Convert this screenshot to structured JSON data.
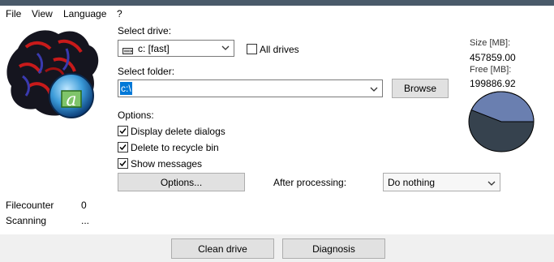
{
  "menu": {
    "file": "File",
    "view": "View",
    "language": "Language",
    "help": "?"
  },
  "drive": {
    "label": "Select drive:",
    "value": "c: [fast]",
    "all_drives_label": "All drives",
    "all_drives_checked": false
  },
  "folder": {
    "label": "Select folder:",
    "value": "c:\\",
    "browse_label": "Browse"
  },
  "options": {
    "heading": "Options:",
    "display_delete_dialogs": {
      "label": "Display delete dialogs",
      "checked": true
    },
    "delete_to_recycle_bin": {
      "label": "Delete to recycle bin",
      "checked": true
    },
    "show_messages": {
      "label": "Show messages",
      "checked": true
    },
    "options_button": "Options...",
    "after_processing_label": "After processing:",
    "after_processing_value": "Do nothing"
  },
  "disk": {
    "size_label": "Size [MB]:",
    "size_value": "457859.00",
    "free_label": "Free [MB]:",
    "free_value": "199886.92",
    "free_color": "#6a7fb0",
    "used_color": "#36424e"
  },
  "status": {
    "filecounter_label": "Filecounter",
    "filecounter_value": "0",
    "scanning_label": "Scanning",
    "scanning_value": "..."
  },
  "footer": {
    "clean_label": "Clean drive",
    "diagnosis_label": "Diagnosis"
  },
  "icons": {
    "logo": "app-logo-figure-icon",
    "drive": "hard-drive-icon"
  }
}
